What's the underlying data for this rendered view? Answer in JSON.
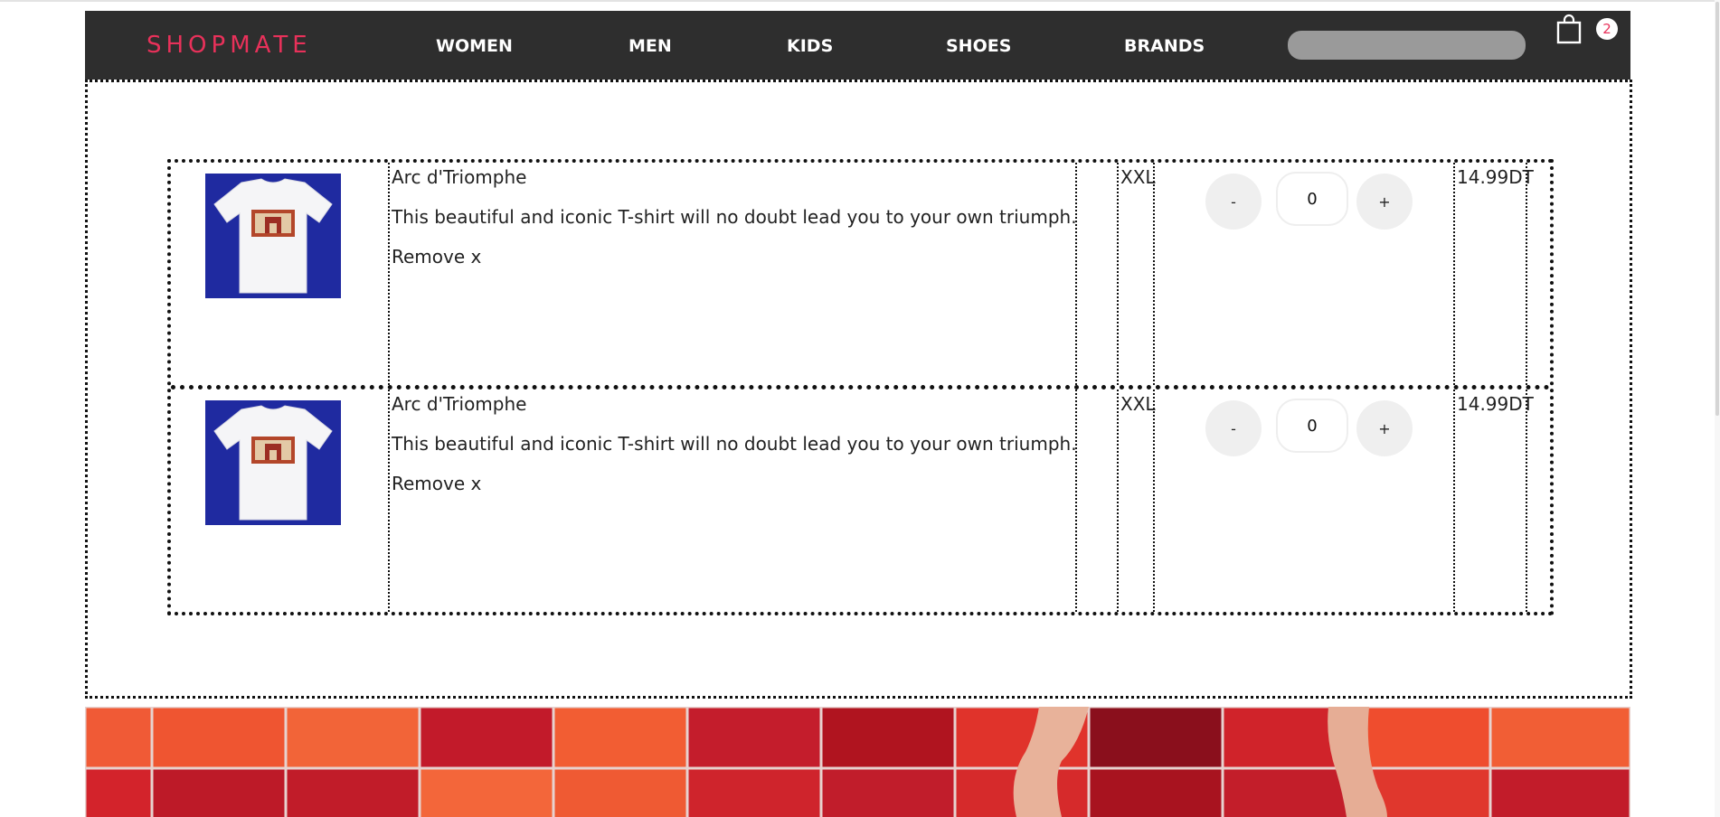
{
  "header": {
    "logo": "SHOPMATE",
    "nav": [
      "WOMEN",
      "MEN",
      "KIDS",
      "SHOES",
      "BRANDS"
    ],
    "search_placeholder": "",
    "cart_count": "2",
    "accent_color": "#e8315a"
  },
  "cart": {
    "items": [
      {
        "title": "Arc d'Triomphe",
        "description": "This beautiful and iconic T-shirt will no doubt lead you to your own triumph.",
        "remove_label": "Remove x",
        "size": "XXL",
        "quantity": "0",
        "minus_label": "-",
        "plus_label": "+",
        "price": "14.99DT"
      },
      {
        "title": "Arc d'Triomphe",
        "description": "This beautiful and iconic T-shirt will no doubt lead you to your own triumph.",
        "remove_label": "Remove x",
        "size": "XXL",
        "quantity": "0",
        "minus_label": "-",
        "plus_label": "+",
        "price": "14.99DT"
      }
    ]
  }
}
